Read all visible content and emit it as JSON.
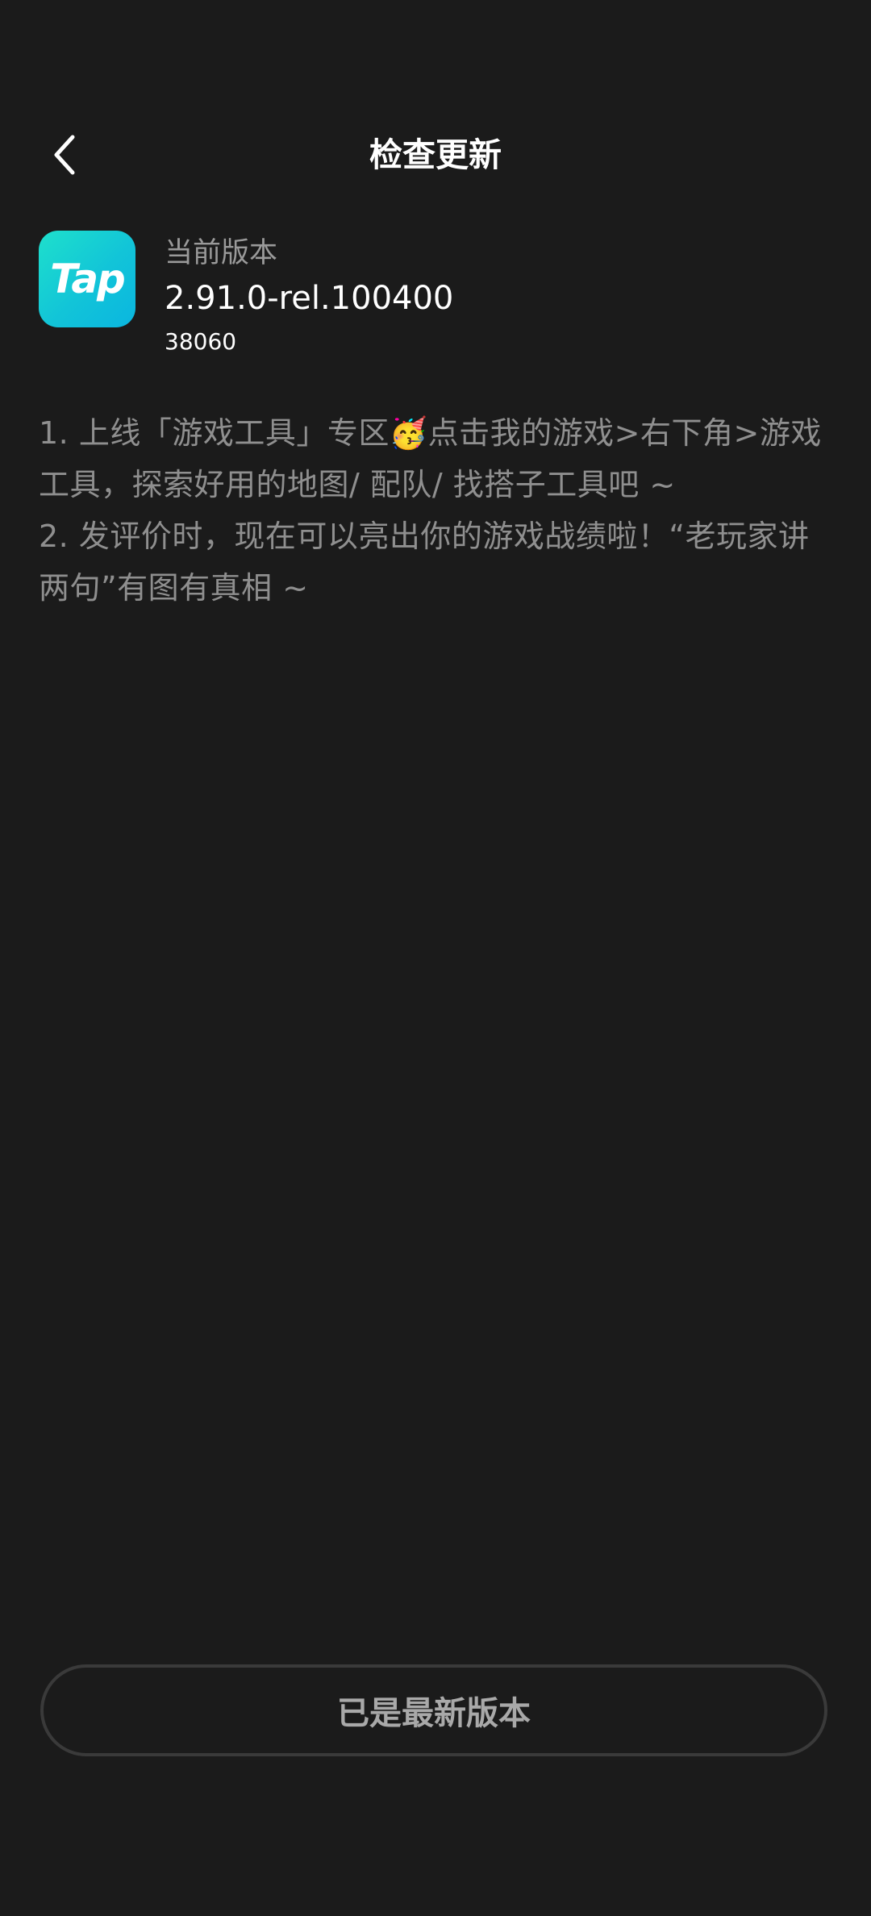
{
  "header": {
    "title": "检查更新",
    "back_icon": "chevron-left-icon"
  },
  "app": {
    "icon_text": "Tap",
    "icon_colors": [
      "#1ee0cc",
      "#0ab6e0"
    ],
    "version_label": "当前版本",
    "version": "2.91.0-rel.100400",
    "build": "38060"
  },
  "release_notes": [
    "1. 上线「游戏工具」专区🥳点击我的游戏>右下角>游戏工具，探索好用的地图/ 配队/ 找搭子工具吧 ~",
    "2. 发评价时，现在可以亮出你的游戏战绩啦！“老玩家讲两句”有图有真相 ~"
  ],
  "footer": {
    "button_label": "已是最新版本"
  },
  "colors": {
    "background": "#1b1b1b",
    "muted_text": "#8f8f8f",
    "button_border": "#3a3a3a"
  }
}
